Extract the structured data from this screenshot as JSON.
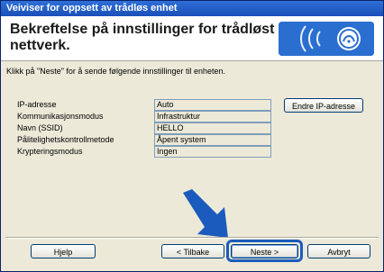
{
  "window": {
    "title": "Veiviser for oppsett av trådløs enhet"
  },
  "header": {
    "title_line1": "Bekreftelse på innstillinger for trådløst",
    "title_line2": "nettverk."
  },
  "instruction": "Klikk på \"Neste\" for å sende følgende innstillinger til enheten.",
  "settings": [
    {
      "label": "IP-adresse",
      "value": "Auto"
    },
    {
      "label": "Kommunikasjonsmodus",
      "value": "Infrastruktur"
    },
    {
      "label": "Navn (SSID)",
      "value": "HELLO"
    },
    {
      "label": "Pålitelighetskontrollmetode",
      "value": "Åpent system"
    },
    {
      "label": "Krypteringsmodus",
      "value": "Ingen"
    }
  ],
  "buttons": {
    "change_ip": "Endre IP-adresse",
    "help": "Hjelp",
    "back": "< Tilbake",
    "next": "Neste >",
    "cancel": "Avbryt"
  },
  "colors": {
    "title_bar": "#1a4fb8",
    "accent_blue": "#1b5bbd",
    "dialog_bg": "#ece9d8"
  },
  "icons": {
    "wifi_logo": "wireless-logo-icon",
    "pointer_arrow": "pointer-arrow-icon"
  }
}
